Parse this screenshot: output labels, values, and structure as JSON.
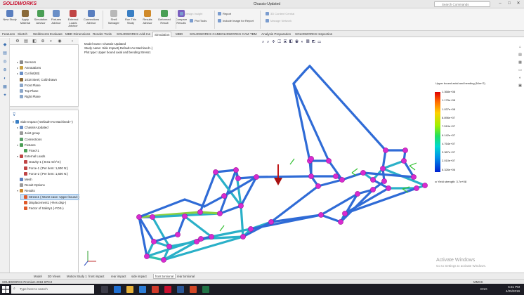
{
  "app": {
    "logo": "SOLIDWORKS",
    "window_title": "Chassis-Updated",
    "search_placeholder": "Search Commands"
  },
  "ribbon": {
    "large_buttons": [
      {
        "label": "New Study",
        "color": "#5a7fbf"
      },
      {
        "label": "Apply Material",
        "color": "#8a6a3a"
      },
      {
        "label": "Simulation Advisor",
        "color": "#4a9f55"
      },
      {
        "label": "Fixtures Advisor",
        "color": "#6a8fc7"
      },
      {
        "label": "External Loads Advisor",
        "color": "#c04545"
      },
      {
        "label": "Connections Advisor",
        "color": "#5a7fbf"
      },
      {
        "label": "Shell Manager",
        "color": "#b8b8b8"
      },
      {
        "label": "Run This Study",
        "color": "#3a7fc4"
      },
      {
        "label": "Results Advisor",
        "color": "#d08a2a"
      },
      {
        "label": "Deformed Result",
        "color": "#4a9f55"
      },
      {
        "label": "Compare Results",
        "color": "#7a5fbf"
      }
    ],
    "small_buttons": [
      {
        "label": "Plot Tools",
        "dim": false
      },
      {
        "label": "Design Insight",
        "dim": true
      },
      {
        "label": "Report",
        "dim": false
      },
      {
        "label": "Include Image for Report",
        "dim": false
      },
      {
        "label": "3D Content Central",
        "dim": true
      },
      {
        "label": "Manage Network",
        "dim": true
      }
    ]
  },
  "command_tabs": [
    {
      "label": "Features",
      "active": false
    },
    {
      "label": "Sketch",
      "active": false
    },
    {
      "label": "Weldments",
      "active": false
    },
    {
      "label": "Evaluate",
      "active": false
    },
    {
      "label": "MBD Dimensions",
      "active": false
    },
    {
      "label": "Render Tools",
      "active": false
    },
    {
      "label": "SOLIDWORKS Add-Ins",
      "active": false
    },
    {
      "label": "Simulation",
      "active": true
    },
    {
      "label": "MBD",
      "active": false
    },
    {
      "label": "SOLIDWORKS CAM",
      "active": false
    },
    {
      "label": "SOLIDWORKS CAM TBM",
      "active": false
    },
    {
      "label": "Analysis Preparation",
      "active": false
    },
    {
      "label": "SOLIDWORKS Inspection",
      "active": false
    }
  ],
  "feature_tree": [
    {
      "label": "Sensors",
      "color": "#8a8a8a",
      "indent": 1,
      "exp": "▸",
      "sel": false
    },
    {
      "label": "Annotations",
      "color": "#c8a040",
      "indent": 1,
      "exp": "▸",
      "sel": false
    },
    {
      "label": "Cut list(93)",
      "color": "#6a8fc7",
      "indent": 1,
      "exp": "▸",
      "sel": false
    },
    {
      "label": "1018 Steel, Cold-drawn",
      "color": "#8a6a3a",
      "indent": 1,
      "exp": "",
      "sel": false
    },
    {
      "label": "Front Plane",
      "color": "#8aa6c9",
      "indent": 1,
      "exp": "",
      "sel": false
    },
    {
      "label": "Top Plane",
      "color": "#8aa6c9",
      "indent": 1,
      "exp": "",
      "sel": false
    },
    {
      "label": "Right Plane",
      "color": "#8aa6c9",
      "indent": 1,
      "exp": "",
      "sel": false
    }
  ],
  "study_tree": [
    {
      "label": "Side Impact (-Default<As Machined>-)",
      "color": "#3a7fc4",
      "indent": 0,
      "exp": "▾",
      "sel": false
    },
    {
      "label": "Chassis-Updated",
      "color": "#6a8fc7",
      "indent": 1,
      "exp": "▸",
      "sel": false
    },
    {
      "label": "Joint group",
      "color": "#9a9a9a",
      "indent": 1,
      "exp": "",
      "sel": false
    },
    {
      "label": "Connections",
      "color": "#5a9f6a",
      "indent": 1,
      "exp": "",
      "sel": false
    },
    {
      "label": "Fixtures",
      "color": "#4a9f55",
      "indent": 1,
      "exp": "▾",
      "sel": false
    },
    {
      "label": "Fixed-1",
      "color": "#4a9f55",
      "indent": 2,
      "exp": "",
      "sel": false
    },
    {
      "label": "External Loads",
      "color": "#c04545",
      "indent": 1,
      "exp": "▾",
      "sel": false
    },
    {
      "label": "Gravity-1 (:9.81 m/s^2:)",
      "color": "#c04545",
      "indent": 2,
      "exp": "",
      "sel": false
    },
    {
      "label": "Force-1 (:Per item: 1,600 N:)",
      "color": "#c04545",
      "indent": 2,
      "exp": "",
      "sel": false
    },
    {
      "label": "Force-2 (:Per item: 1,600 N:)",
      "color": "#c04545",
      "indent": 2,
      "exp": "",
      "sel": false
    },
    {
      "label": "Mesh",
      "color": "#5a7fbf",
      "indent": 1,
      "exp": "",
      "sel": false
    },
    {
      "label": "Result Options",
      "color": "#9a9a9a",
      "indent": 1,
      "exp": "",
      "sel": false
    },
    {
      "label": "Results",
      "color": "#d08a2a",
      "indent": 1,
      "exp": "▾",
      "sel": false
    },
    {
      "label": "Stress1 (-Worst case: Upper bound-)",
      "color": "#e05a2a",
      "indent": 2,
      "exp": "",
      "sel": true
    },
    {
      "label": "Displacement1 (-Res disp-)",
      "color": "#e05a2a",
      "indent": 2,
      "exp": "",
      "sel": false
    },
    {
      "label": "Factor of Safety1 (-FOS-)",
      "color": "#e05a2a",
      "indent": 2,
      "exp": "",
      "sel": false
    }
  ],
  "viewport": {
    "info_lines": [
      "Model name: Chassis-Updated",
      "Study name: Side Impact(-Default<As Machined>-)",
      "Plot type: Upper bound axial and bending Stress1"
    ],
    "legend_title": "Upper bound axial and bending (N/m^2)",
    "legend_values": [
      "1.368e+08",
      "1.175e+08",
      "1.037e+08",
      "8.896e+07",
      "7.519e+07",
      "6.142e+07",
      "4.764e+07",
      "3.387e+07",
      "2.010e+07",
      "6.326e+06"
    ],
    "yield_label": "Yield strength: 3.7e+08",
    "watermark": "Activate Windows",
    "watermark_sub": "Go to Settings to activate Windows."
  },
  "bottom_tabs": [
    {
      "label": "Model",
      "active": false
    },
    {
      "label": "3D Views",
      "active": false
    },
    {
      "label": "Motion Study 1",
      "active": false
    },
    {
      "label": "front impact",
      "active": false
    },
    {
      "label": "rear impact",
      "active": false
    },
    {
      "label": "side impact",
      "active": false
    },
    {
      "label": "front torsional",
      "active": true
    },
    {
      "label": "rear torsional",
      "active": false
    }
  ],
  "status": {
    "left": "SOLIDWORKS Premium 2018 SP0.0",
    "right": "MMGS"
  },
  "taskbar": {
    "search_placeholder": "Type here to search",
    "lang": "ENG",
    "time": "6:31 PM",
    "date": "4/25/2019"
  }
}
